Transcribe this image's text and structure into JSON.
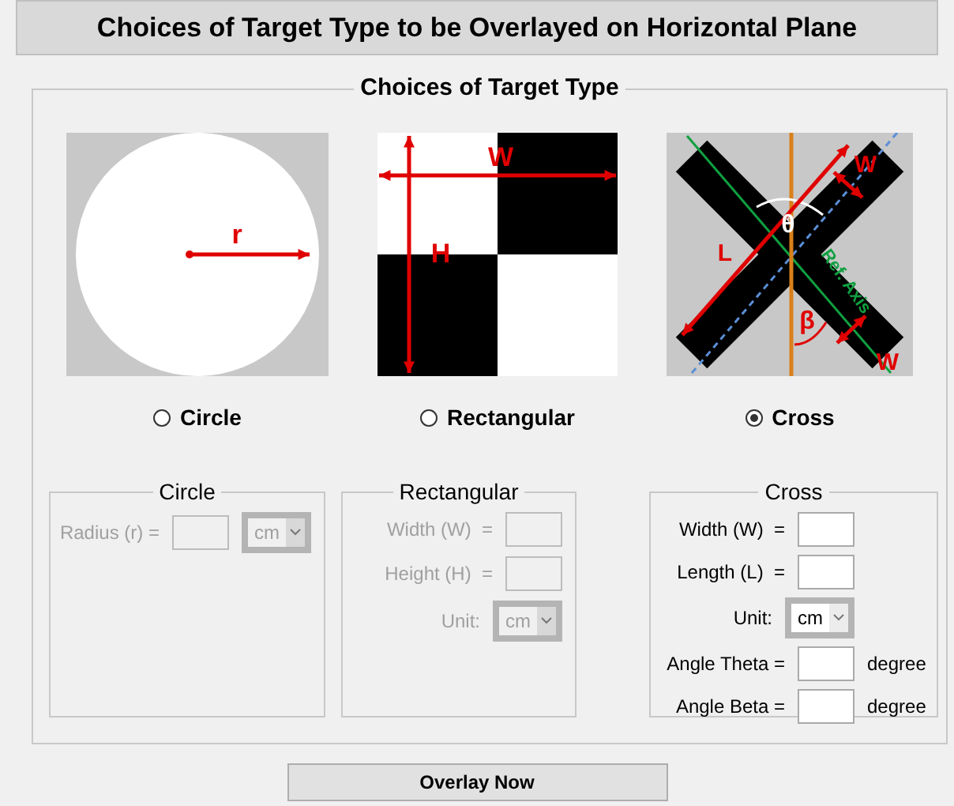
{
  "title": "Choices of Target Type to be Overlayed on Horizontal Plane",
  "panel": {
    "legend": "Choices of Target Type",
    "options": [
      {
        "kind": "circle",
        "label": "Circle",
        "selected": false,
        "labels": [
          "r"
        ]
      },
      {
        "kind": "rectangular",
        "label": "Rectangular",
        "selected": false,
        "labels": [
          "W",
          "H"
        ]
      },
      {
        "kind": "cross",
        "label": "Cross",
        "selected": true,
        "labels": [
          "W",
          "θ",
          "L",
          "Ref. Axis",
          "β",
          "W"
        ]
      }
    ]
  },
  "groups": [
    {
      "title": "Circle",
      "disabled": true,
      "fields": [
        {
          "kind": "input_unit",
          "label": "Radius (r) =",
          "unit": "cm"
        }
      ]
    },
    {
      "title": "Rectangular",
      "disabled": true,
      "fields": [
        {
          "kind": "input",
          "label": "Width (W)  ="
        },
        {
          "kind": "input",
          "label": "Height (H)  ="
        },
        {
          "kind": "unit",
          "label": "Unit:",
          "unit": "cm"
        }
      ]
    },
    {
      "title": "Cross",
      "disabled": false,
      "fields": [
        {
          "kind": "input",
          "label": "Width (W)  ="
        },
        {
          "kind": "input",
          "label": "Length (L)  ="
        },
        {
          "kind": "unit",
          "label": "Unit:",
          "unit": "cm"
        },
        {
          "kind": "input",
          "label": "Angle Theta =",
          "suffix": "degree"
        },
        {
          "kind": "input",
          "label": "Angle Beta =",
          "suffix": "degree"
        }
      ]
    }
  ],
  "button": "Overlay Now"
}
